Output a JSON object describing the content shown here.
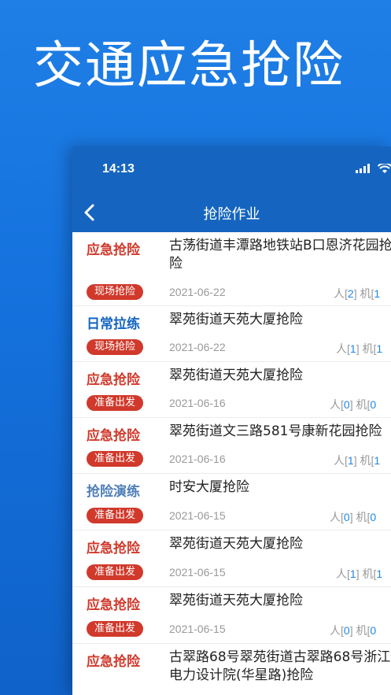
{
  "hero": {
    "title": "交通应急抢险"
  },
  "status_bar": {
    "time": "14:13"
  },
  "nav": {
    "title": "抢险作业"
  },
  "colors": {
    "emergency": "#d0392b",
    "daily": "#1565c0",
    "drill": "#4f7fb8",
    "badge": "#d0392b"
  },
  "rows": [
    {
      "type": "应急抢险",
      "type_kind": "emergency",
      "title": "古荡街道丰潭路地铁站B口恩济花园抢险",
      "badge": "现场抢险",
      "date": "2021-06-22",
      "people_label": "人[",
      "people": "2",
      "machine_label": "] 机[",
      "machines": "1"
    },
    {
      "type": "日常拉练",
      "type_kind": "daily",
      "title": "翠苑街道天苑大厦抢险",
      "badge": "现场抢险",
      "date": "2021-06-22",
      "people_label": "人[",
      "people": "1",
      "machine_label": "] 机[",
      "machines": "1"
    },
    {
      "type": "应急抢险",
      "type_kind": "emergency",
      "title": "翠苑街道天苑大厦抢险",
      "badge": "准备出发",
      "date": "2021-06-16",
      "people_label": "人[",
      "people": "0",
      "machine_label": "] 机[",
      "machines": "0"
    },
    {
      "type": "应急抢险",
      "type_kind": "emergency",
      "title": "翠苑街道文三路581号康新花园抢险",
      "badge": "准备出发",
      "date": "2021-06-16",
      "people_label": "人[",
      "people": "1",
      "machine_label": "] 机[",
      "machines": "1"
    },
    {
      "type": "抢险演练",
      "type_kind": "drill",
      "title": "时安大厦抢险",
      "badge": "准备出发",
      "date": "2021-06-15",
      "people_label": "人[",
      "people": "0",
      "machine_label": "] 机[",
      "machines": "0"
    },
    {
      "type": "应急抢险",
      "type_kind": "emergency",
      "title": "翠苑街道天苑大厦抢险",
      "badge": "准备出发",
      "date": "2021-06-15",
      "people_label": "人[",
      "people": "1",
      "machine_label": "] 机[",
      "machines": "1"
    },
    {
      "type": "应急抢险",
      "type_kind": "emergency",
      "title": "翠苑街道天苑大厦抢险",
      "badge": "准备出发",
      "date": "2021-06-15",
      "people_label": "人[",
      "people": "0",
      "machine_label": "] 机[",
      "machines": "0"
    },
    {
      "type": "应急抢险",
      "type_kind": "emergency",
      "title": "古翠路68号翠苑街道古翠路68号浙江省电力设计院(华星路)抢险",
      "badge": "",
      "date": "",
      "people_label": "",
      "people": "",
      "machine_label": "",
      "machines": ""
    }
  ]
}
